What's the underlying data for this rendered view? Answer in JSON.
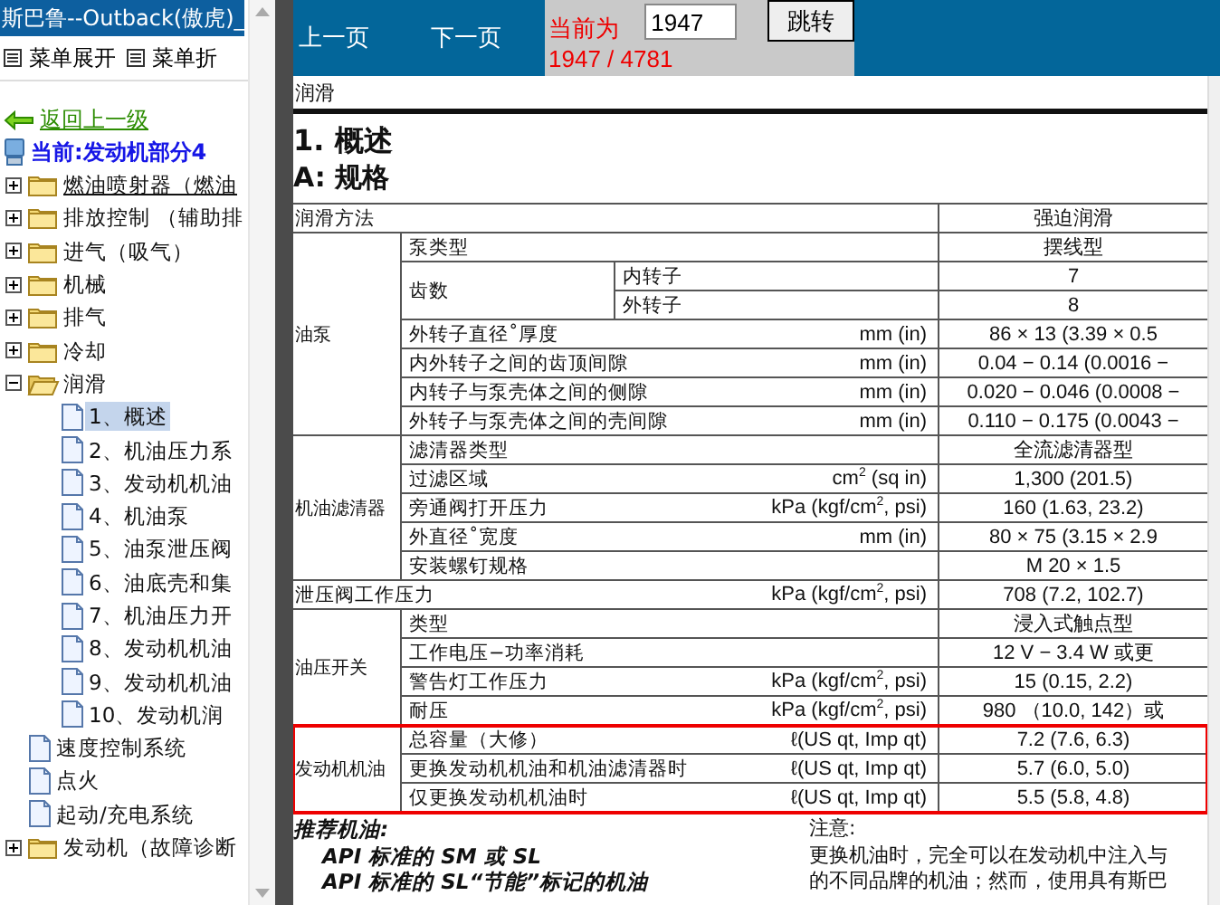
{
  "sidebar": {
    "title": "斯巴鲁--Outback(傲虎)_",
    "menu": [
      "菜单展开",
      "菜单折"
    ],
    "back_link": "返回上一级",
    "current": "当前:发动机部分4",
    "tree": [
      {
        "kind": "folder",
        "label": "燃油喷射器（燃油",
        "expanded": false,
        "selected": false,
        "hovered": true
      },
      {
        "kind": "folder",
        "label": "排放控制 （辅助排",
        "expanded": false,
        "selected": false,
        "hovered": false
      },
      {
        "kind": "folder",
        "label": "进气（吸气）",
        "expanded": false,
        "selected": false,
        "hovered": false
      },
      {
        "kind": "folder",
        "label": "机械",
        "expanded": false,
        "selected": false,
        "hovered": false
      },
      {
        "kind": "folder",
        "label": "排气",
        "expanded": false,
        "selected": false,
        "hovered": false
      },
      {
        "kind": "folder",
        "label": "冷却",
        "expanded": false,
        "selected": false,
        "hovered": false
      },
      {
        "kind": "folder",
        "label": "润滑",
        "expanded": true,
        "selected": false,
        "hovered": false,
        "children": [
          {
            "kind": "doc",
            "label": "1、概述",
            "selected": true,
            "hovered": false
          },
          {
            "kind": "doc",
            "label": "2、机油压力系",
            "selected": false,
            "hovered": false
          },
          {
            "kind": "doc",
            "label": "3、发动机机油",
            "selected": false,
            "hovered": false
          },
          {
            "kind": "doc",
            "label": "4、机油泵",
            "selected": false,
            "hovered": false
          },
          {
            "kind": "doc",
            "label": "5、油泵泄压阀",
            "selected": false,
            "hovered": false
          },
          {
            "kind": "doc",
            "label": "6、油底壳和集",
            "selected": false,
            "hovered": false
          },
          {
            "kind": "doc",
            "label": "7、机油压力开",
            "selected": false,
            "hovered": false
          },
          {
            "kind": "doc",
            "label": "8、发动机机油",
            "selected": false,
            "hovered": false
          },
          {
            "kind": "doc",
            "label": "9、发动机机油",
            "selected": false,
            "hovered": false
          },
          {
            "kind": "doc",
            "label": "10、发动机润",
            "selected": false,
            "hovered": false
          }
        ]
      },
      {
        "kind": "doc",
        "label": "速度控制系统",
        "selected": false,
        "hovered": false
      },
      {
        "kind": "doc",
        "label": "点火",
        "selected": false,
        "hovered": false
      },
      {
        "kind": "doc",
        "label": "起动/充电系统",
        "selected": false,
        "hovered": false
      },
      {
        "kind": "folder",
        "label": "发动机（故障诊断",
        "expanded": false,
        "selected": false,
        "hovered": false
      }
    ]
  },
  "toolbar": {
    "prev": "上一页",
    "next": "下一页",
    "page_label": "当前为",
    "page_input": "1947",
    "go_button": "跳转",
    "page_count": "1947 / 4781"
  },
  "document": {
    "header": "润滑",
    "heading": "1. 概述",
    "subheading": "A: 规格",
    "spec_groups": [
      {
        "highlighted": false,
        "rows": [
          {
            "kind": "plain",
            "item": "润滑方法",
            "value": "强迫润滑"
          }
        ]
      },
      {
        "label": "油泵",
        "highlighted": false,
        "rows": [
          {
            "kind": "plain",
            "item": "泵类型",
            "value": "摆线型"
          },
          {
            "kind": "split",
            "item": "齿数",
            "parts": [
              {
                "sub": "内转子",
                "value": "7"
              },
              {
                "sub": "外转子",
                "value": "8"
              }
            ]
          },
          {
            "kind": "plain",
            "item": "外转子直径˚厚度",
            "unit": "mm (in)",
            "value": "86 × 13 (3.39 × 0.5"
          },
          {
            "kind": "plain",
            "item": "内外转子之间的齿顶间隙",
            "unit": "mm (in)",
            "value": "0.04 − 0.14 (0.0016 −"
          },
          {
            "kind": "plain",
            "item": "内转子与泵壳体之间的侧隙",
            "unit": "mm (in)",
            "value": "0.020 − 0.046 (0.0008 −"
          },
          {
            "kind": "plain",
            "item": "外转子与泵壳体之间的壳间隙",
            "unit": "mm (in)",
            "value": "0.110 − 0.175 (0.0043 −"
          }
        ]
      },
      {
        "label": "机油滤清器",
        "highlighted": false,
        "rows": [
          {
            "kind": "plain",
            "item": "滤清器类型",
            "value": "全流滤清器型"
          },
          {
            "kind": "plain",
            "item": "过滤区域",
            "unit": "cm$^{2}$ (sq in)",
            "value": "1,300 (201.5)"
          },
          {
            "kind": "plain",
            "item": "旁通阀打开压力",
            "unit": "kPa (kgf/cm$^{2}$, psi)",
            "value": "160 (1.63, 23.2)"
          },
          {
            "kind": "plain",
            "item": "外直径˚宽度",
            "unit": "mm (in)",
            "value": "80 × 75 (3.15 × 2.9"
          },
          {
            "kind": "plain",
            "item": "安装螺钉规格",
            "value": "M 20 × 1.5"
          }
        ]
      },
      {
        "highlighted": false,
        "rows": [
          {
            "kind": "plain",
            "item": "泄压阀工作压力",
            "unit": "kPa (kgf/cm$^{2}$, psi)",
            "value": "708 (7.2, 102.7)"
          }
        ]
      },
      {
        "label": "油压开关",
        "highlighted": false,
        "rows": [
          {
            "kind": "plain",
            "item": "类型",
            "value": "浸入式触点型"
          },
          {
            "kind": "plain",
            "item": "工作电压−功率消耗",
            "value": "12 V − 3.4 W 或更"
          },
          {
            "kind": "plain",
            "item": "警告灯工作压力",
            "unit": "kPa (kgf/cm$^{2}$, psi)",
            "value": "15 (0.15, 2.2)"
          },
          {
            "kind": "plain",
            "item": "耐压",
            "unit": "kPa (kgf/cm$^{2}$, psi)",
            "value": "980 （10.0, 142）或"
          }
        ]
      },
      {
        "label": "发动机机油",
        "highlighted": true,
        "rows": [
          {
            "kind": "plain",
            "item": "总容量（大修）",
            "unit": "ℓ(US qt, Imp qt)",
            "value": "7.2 (7.6, 6.3)"
          },
          {
            "kind": "plain",
            "item": "更换发动机机油和机油滤清器时",
            "unit": "ℓ(US qt, Imp qt)",
            "value": "5.7 (6.0, 5.0)"
          },
          {
            "kind": "plain",
            "item": "仅更换发动机机油时",
            "unit": "ℓ(US qt, Imp qt)",
            "value": "5.5 (5.8, 4.8)"
          }
        ]
      }
    ],
    "notes": [
      {
        "kind": "recommend",
        "title": "推荐机油:",
        "lines": [
          "API 标准的 SM 或 SL",
          "API 标准的 SL“节能”标记的机油"
        ]
      },
      {
        "kind": "caution",
        "title": "注意:",
        "lines": [
          "更换机油时，完全可以在发动机中注入与",
          "的不同品牌的机油；然而，使用具有斯巴"
        ]
      }
    ]
  }
}
